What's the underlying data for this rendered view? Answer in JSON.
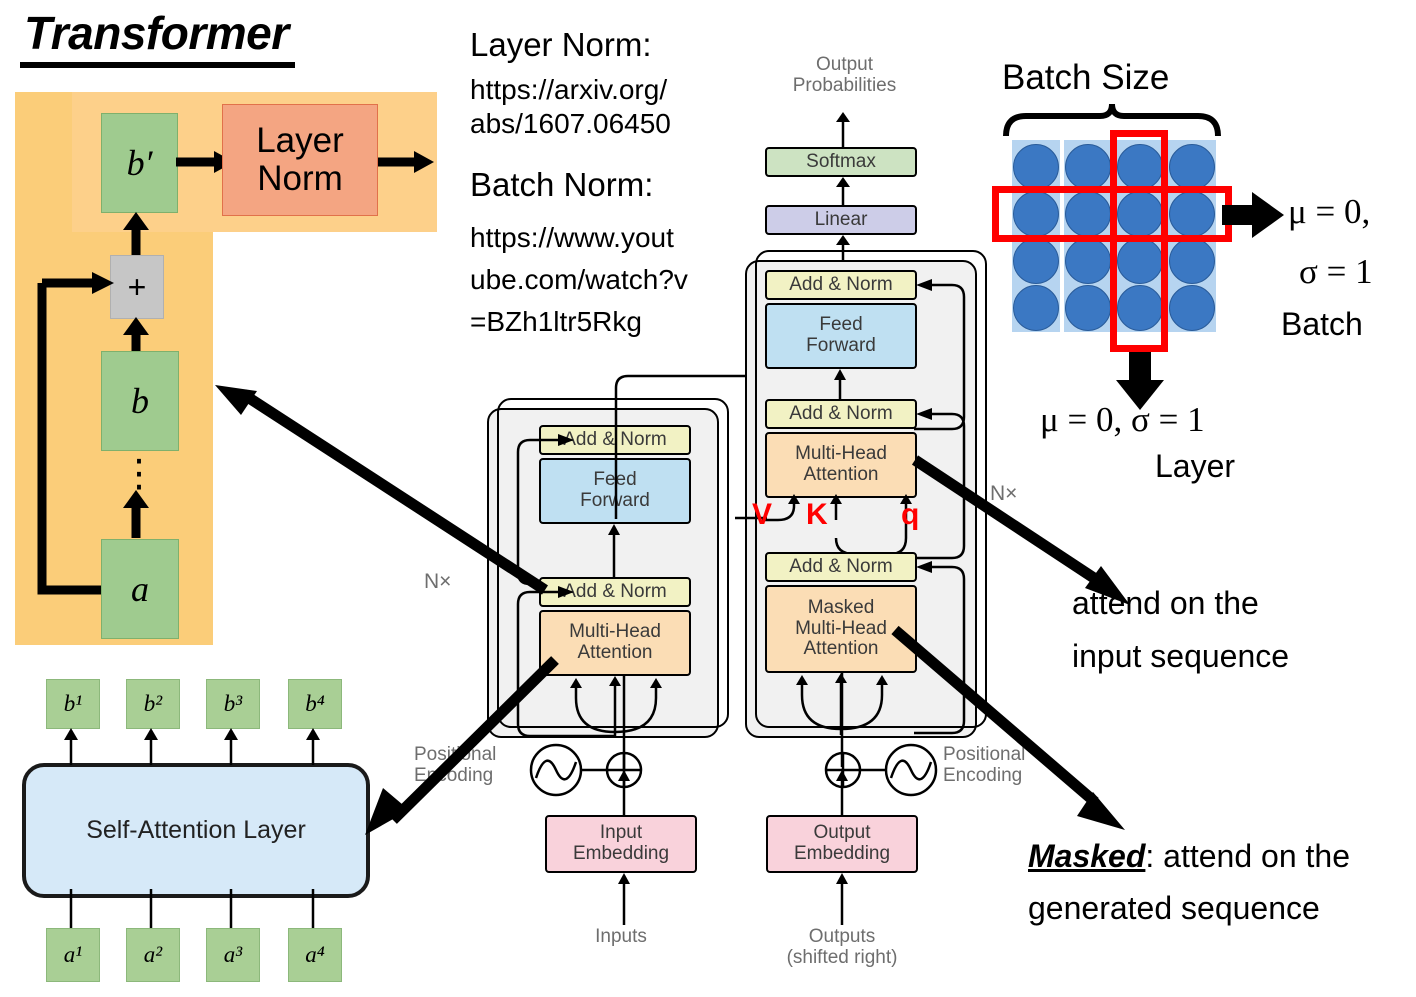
{
  "title": "Transformer",
  "residual_panel": {
    "b_prime_label": "b′",
    "layer_norm_label": "Layer\nNorm",
    "plus_label": "+",
    "b_label": "b",
    "a_label": "a",
    "vdots": "⋮"
  },
  "references": {
    "layer_norm_heading": "Layer Norm:",
    "layer_norm_url_line1": "https://arxiv.org/",
    "layer_norm_url_line2": "abs/1607.06450",
    "batch_norm_heading": "Batch Norm:",
    "batch_norm_url_line1": "https://www.yout",
    "batch_norm_url_line2": "ube.com/watch?v",
    "batch_norm_url_line3": "=BZh1ltr5Rkg"
  },
  "transformer": {
    "output_probabilities_line1": "Output",
    "output_probabilities_line2": "Probabilities",
    "softmax": "Softmax",
    "linear": "Linear",
    "add_norm": "Add & Norm",
    "feed_forward_line1": "Feed",
    "feed_forward_line2": "Forward",
    "multi_head_line1": "Multi-Head",
    "multi_head_line2": "Attention",
    "masked_line1": "Masked",
    "masked_line2": "Multi-Head",
    "masked_line3": "Attention",
    "nx_label": "N×",
    "positional_encoding_line1": "Positional",
    "positional_encoding_line2": "Encoding",
    "input_embedding_line1": "Input",
    "input_embedding_line2": "Embedding",
    "output_embedding_line1": "Output",
    "output_embedding_line2": "Embedding",
    "inputs_label": "Inputs",
    "outputs_label": "Outputs",
    "outputs_shifted_label": "(shifted right)",
    "v_label": "V",
    "k_label": "K",
    "q_label": "q"
  },
  "self_attention": {
    "layer_label": "Self-Attention Layer",
    "outputs": [
      "b¹",
      "b²",
      "b³",
      "b⁴"
    ],
    "inputs": [
      "a¹",
      "a²",
      "a³",
      "a⁴"
    ]
  },
  "batch_norm_figure": {
    "batch_size_label": "Batch Size",
    "batch_stat_line1": "μ = 0,",
    "batch_stat_line2": "σ = 1",
    "batch_word": "Batch",
    "layer_stat": "μ = 0, σ = 1",
    "layer_word": "Layer",
    "columns": 4,
    "rows": 4,
    "highlight_row_index": 1,
    "highlight_col_index": 2,
    "dot_color": "#3b78c3",
    "column_color": "#b6d4f0",
    "highlight_color": "#ff0000"
  },
  "annotations": {
    "attend_input_line1": "attend on the",
    "attend_input_line2": "input sequence",
    "masked_word": "Masked",
    "masked_rest": ": attend on the",
    "masked_line2": "generated sequence"
  },
  "colors": {
    "panel_orange": "#fbcd79",
    "green_box": "#9fcb8f",
    "layer_norm": "#f4a582",
    "add_norm": "#f2f2c4",
    "feed_forward": "#bfe0f2",
    "multi_head": "#fbddb5",
    "softmax": "#cde3c2",
    "linear": "#cdcde8",
    "embedding": "#f9d2db",
    "self_attention": "#d6e9f8"
  }
}
